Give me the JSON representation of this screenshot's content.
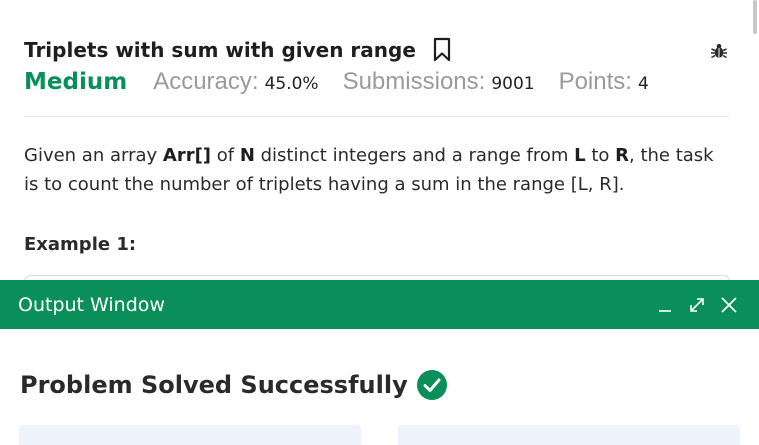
{
  "problem": {
    "title": "Triplets with sum with given range",
    "difficulty": "Medium",
    "accuracy_label": "Accuracy:",
    "accuracy_value": "45.0%",
    "submissions_label": "Submissions:",
    "submissions_value": "9001",
    "points_label": "Points:",
    "points_value": "4",
    "bookmark_icon": "bookmark-icon",
    "bug_icon": "bug-icon"
  },
  "description": {
    "t1": "Given an array ",
    "b1": "Arr[]",
    "t2": " of ",
    "b2": "N",
    "t3": " distinct integers and a range from ",
    "b3": "L",
    "t4": " to ",
    "b4": "R",
    "t5": ", the task is to count the number of triplets having a sum in the range [L, R]."
  },
  "example": {
    "heading": "Example 1:"
  },
  "output_window": {
    "title": "Output Window",
    "minimize_icon": "minimize-icon",
    "expand_icon": "expand-icon",
    "close_icon": "close-icon",
    "result_text": "Problem Solved Successfully",
    "result_icon": "check-circle-icon"
  },
  "colors": {
    "accent_green": "#0a8f5a",
    "muted_gray": "#9a9a9a",
    "card_bg": "#eef3fb"
  }
}
